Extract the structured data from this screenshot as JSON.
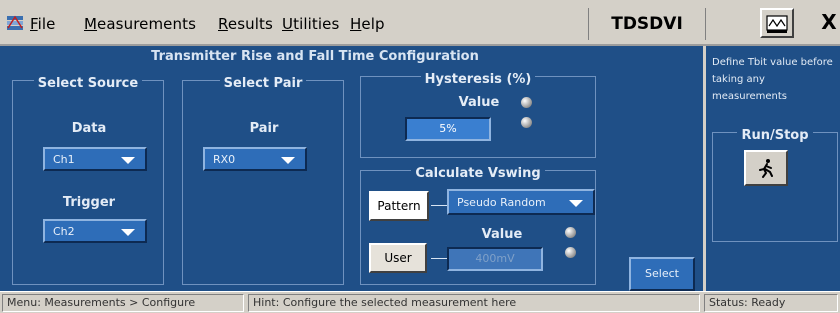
{
  "menubar": {
    "items": [
      {
        "pre": "",
        "u": "F",
        "post": "ile"
      },
      {
        "pre": "",
        "u": "M",
        "post": "easurements"
      },
      {
        "pre": "",
        "u": "R",
        "post": "esults"
      },
      {
        "pre": "",
        "u": "U",
        "post": "tilities"
      },
      {
        "pre": "",
        "u": "H",
        "post": "elp"
      }
    ],
    "app_title": "TDSDVI",
    "close_label": "X"
  },
  "main": {
    "title": "Transmitter Rise and Fall Time Configuration",
    "select_source": {
      "heading": "Select Source",
      "data_label": "Data",
      "data_value": "Ch1",
      "trigger_label": "Trigger",
      "trigger_value": "Ch2"
    },
    "select_pair": {
      "heading": "Select Pair",
      "pair_label": "Pair",
      "pair_value": "RX0"
    },
    "hysteresis": {
      "heading": "Hysteresis (%)",
      "value_label": "Value",
      "value": "5%"
    },
    "vswing": {
      "heading": "Calculate Vswing",
      "pattern_button": "Pattern",
      "pattern_value": "Pseudo Random",
      "user_button": "User",
      "value_label": "Value",
      "value": "400mV"
    },
    "select_button": "Select"
  },
  "side": {
    "note": "Define Tbit value before taking any measurements",
    "run_stop_label": "Run/Stop"
  },
  "statusbar": {
    "menu": "Menu: Measurements > Configure",
    "hint": "Hint: Configure the selected measurement here",
    "status": "Status: Ready"
  }
}
